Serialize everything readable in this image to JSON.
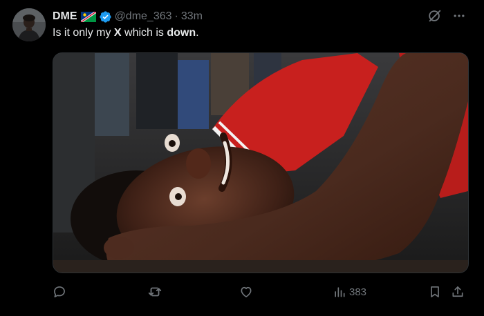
{
  "author": {
    "display_name": "DME",
    "handle": "@dme_363",
    "time_separator": "·",
    "time": "33m"
  },
  "icons": {
    "avatar": "avatar",
    "flag": "namibia-flag-icon",
    "verified": "verified-badge-icon",
    "grok": "grok-icon",
    "more": "more-icon",
    "reply": "reply-icon",
    "repost": "repost-icon",
    "like": "like-icon",
    "views": "views-icon",
    "bookmark": "bookmark-icon",
    "share": "share-icon"
  },
  "post": {
    "text_part1": "Is it only my ",
    "text_bold1": "X",
    "text_part2": " which is ",
    "text_bold2": "down",
    "text_part3": "."
  },
  "actions": {
    "views_count": "383"
  },
  "colors": {
    "background": "#000000",
    "text_primary": "#e7e9ea",
    "text_secondary": "#71767b",
    "verified_blue": "#1d9bf0"
  }
}
